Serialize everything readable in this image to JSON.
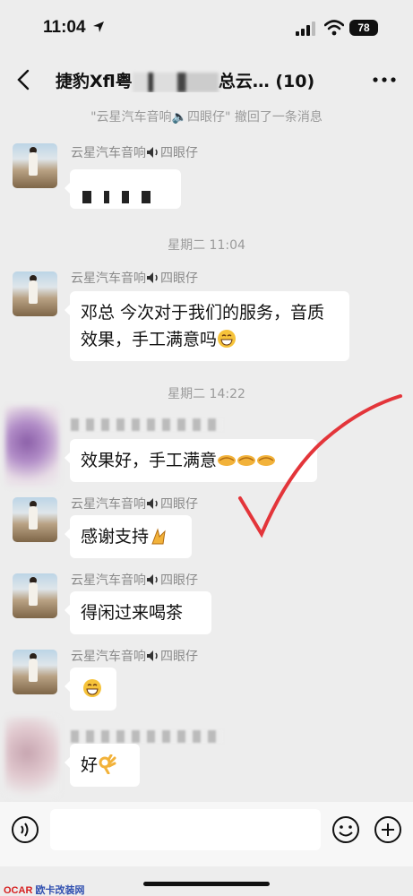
{
  "status": {
    "time": "11:04",
    "battery": "78"
  },
  "header": {
    "title_prefix": "捷豹Xfl粤",
    "title_suffix": "总云…",
    "count": "(10)"
  },
  "recall_notice": "\"云星汽车音响🔈四眼仔\" 撤回了一条消息",
  "timestamps": [
    "星期二 11:04",
    "星期二 14:22"
  ],
  "sender_name": "云星汽车音响",
  "sender_suffix": "四眼仔",
  "messages": [
    {
      "text": ""
    },
    {
      "text": "邓总 今次对于我们的服务，音质效果，手工满意吗"
    },
    {
      "text": "效果好，手工满意"
    },
    {
      "text": "感谢支持"
    },
    {
      "text": "得闲过来喝茶"
    },
    {
      "text": ""
    },
    {
      "text": "好"
    }
  ],
  "watermark": {
    "brand_a": "OCAR",
    "brand_b": "欧卡改装网"
  },
  "icons": [
    "location-arrow-icon",
    "signal-icon",
    "wifi-icon",
    "back-icon",
    "more-icon",
    "speaker-icon",
    "grin-emoji-icon",
    "handshake-emoji-icon",
    "praying-hands-icon",
    "ok-hand-icon",
    "voice-icon",
    "emoji-icon",
    "plus-icon",
    "checkmark-annotation"
  ]
}
